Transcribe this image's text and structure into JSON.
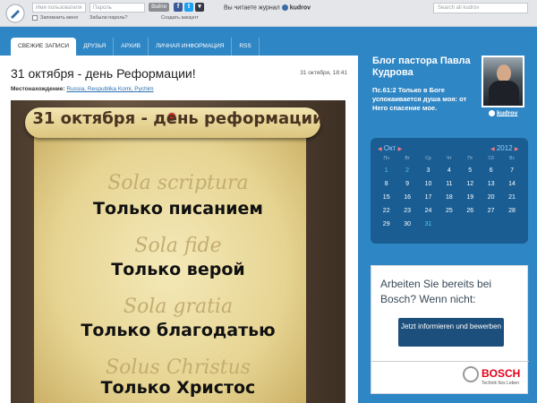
{
  "topbar": {
    "username_placeholder": "Имя пользователя",
    "password_placeholder": "Пароль",
    "login_label": "Войти",
    "remember_label": "Запомнить меня",
    "forgot_label": "Забыли пароль?",
    "create_account_label": "Создать аккаунт",
    "reading_prefix": "Вы читаете журнал",
    "reading_user": "kudrov",
    "search_placeholder": "Search all kudrov",
    "social": [
      {
        "icon": "facebook-icon",
        "glyph": "f",
        "color": "#3b5998"
      },
      {
        "icon": "twitter-icon",
        "glyph": "t",
        "color": "#1da1f2"
      },
      {
        "icon": "more-icon",
        "glyph": "▾",
        "color": "#333a44"
      }
    ]
  },
  "nav": {
    "tabs": [
      {
        "label": "СВЕЖИЕ ЗАПИСИ",
        "active": true
      },
      {
        "label": "ДРУЗЬЯ",
        "active": false
      },
      {
        "label": "АРХИВ",
        "active": false
      },
      {
        "label": "ЛИЧНАЯ ИНФОРМАЦИЯ",
        "active": false
      },
      {
        "label": "RSS",
        "active": false
      }
    ]
  },
  "post": {
    "title": "31 октября - день Реформации!",
    "date": "31 октября, 18:41",
    "location_label": "Местонахождение:",
    "location_value": "Russia, Respublika Komi, Pychim"
  },
  "poster": {
    "heading": "31 октября - день реформации",
    "lines": [
      {
        "latin": "Sola scriptura",
        "russian": "Только писанием"
      },
      {
        "latin": "Sola fide",
        "russian": "Только верой"
      },
      {
        "latin": "Sola gratia",
        "russian": "Только благодатью"
      },
      {
        "latin": "Solus Christus",
        "russian": "Только Христос"
      }
    ]
  },
  "sidebar": {
    "blog_title": "Блог пастора Павла Кудрова",
    "verse": "Пс.61:2 Только в Боге успокаивается душа моя: от Него спасение мое.",
    "user": "kudrov"
  },
  "calendar": {
    "month": "Окт",
    "year": "2012",
    "prev_arrow": "◀",
    "next_arrow": "▶",
    "weekdays": [
      "Пн",
      "Вт",
      "Ср",
      "Чт",
      "Пт",
      "Сб",
      "Вс"
    ],
    "weeks": [
      [
        "1",
        "2",
        "3",
        "4",
        "5",
        "6",
        "7"
      ],
      [
        "8",
        "9",
        "10",
        "11",
        "12",
        "13",
        "14"
      ],
      [
        "15",
        "16",
        "17",
        "18",
        "19",
        "20",
        "21"
      ],
      [
        "22",
        "23",
        "24",
        "25",
        "26",
        "27",
        "28"
      ],
      [
        "29",
        "30",
        "31",
        "",
        "",
        "",
        ""
      ]
    ],
    "linked_days": [
      "1",
      "2",
      "31"
    ]
  },
  "ad": {
    "headline": "Arbeiten Sie bereits bei Bosch? Wenn nicht:",
    "button": "Jetzt informieren und bewerben",
    "brand": "BOSCH",
    "tagline": "Technik fürs Leben"
  }
}
